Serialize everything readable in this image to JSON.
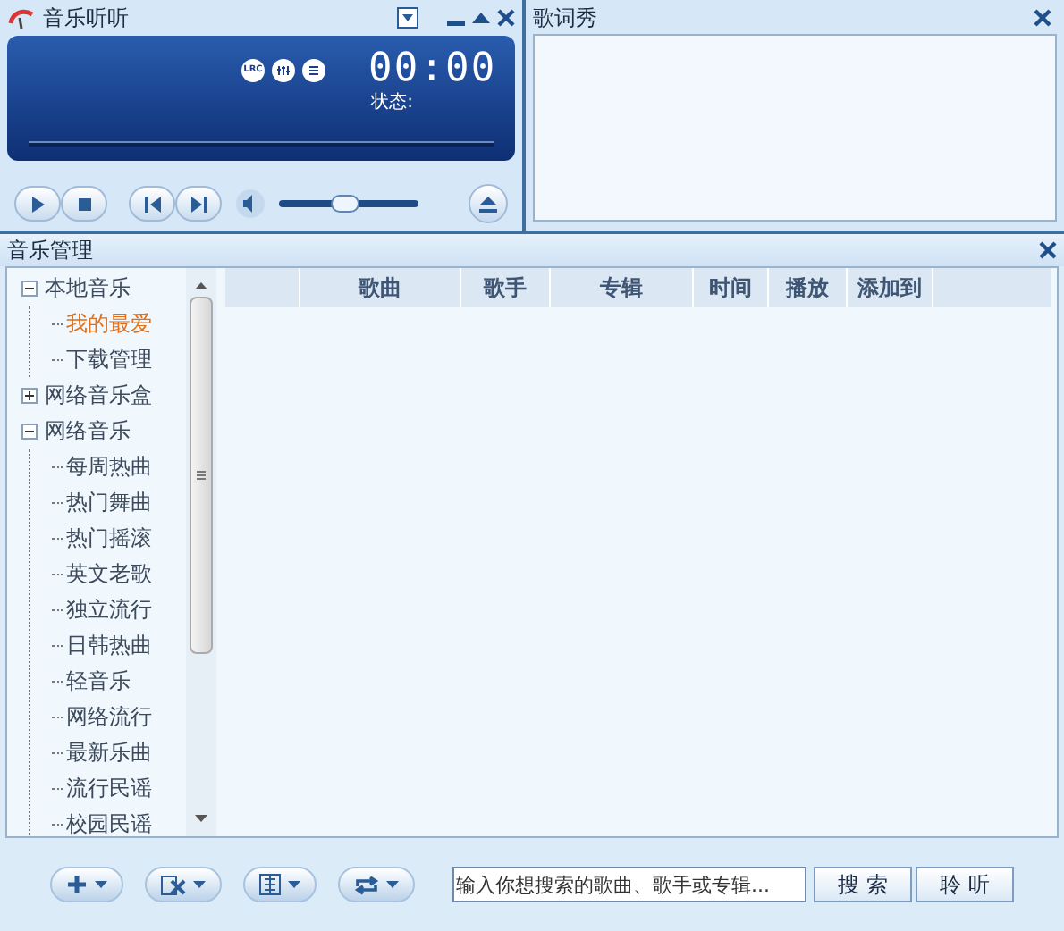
{
  "player": {
    "title": "音乐听听",
    "lrc_label": "LRC",
    "time": "00:00",
    "status": "状态:",
    "progress": {
      "level": 0
    },
    "volume": {
      "level": 0.48
    }
  },
  "lyrics": {
    "title": "歌词秀"
  },
  "manager": {
    "title": "音乐管理",
    "tree": [
      {
        "label": "本地音乐",
        "expanded": true,
        "selected": false,
        "children": [
          {
            "label": "我的最爱",
            "selected": true
          },
          {
            "label": "下载管理",
            "selected": false
          }
        ]
      },
      {
        "label": "网络音乐盒",
        "expanded": false,
        "selected": false
      },
      {
        "label": "网络音乐",
        "expanded": true,
        "selected": false,
        "children": [
          {
            "label": "每周热曲",
            "selected": false
          },
          {
            "label": "热门舞曲",
            "selected": false
          },
          {
            "label": "热门摇滚",
            "selected": false
          },
          {
            "label": "英文老歌",
            "selected": false
          },
          {
            "label": "独立流行",
            "selected": false
          },
          {
            "label": "日韩热曲",
            "selected": false
          },
          {
            "label": "轻音乐",
            "selected": false
          },
          {
            "label": "网络流行",
            "selected": false
          },
          {
            "label": "最新乐曲",
            "selected": false
          },
          {
            "label": "流行民谣",
            "selected": false
          },
          {
            "label": "校园民谣",
            "selected": false
          }
        ]
      }
    ],
    "columns": [
      "歌曲",
      "歌手",
      "专辑",
      "时间",
      "播放",
      "添加到"
    ],
    "search": {
      "placeholder": "输入你想搜索的歌曲、歌手或专辑..."
    },
    "buttons": [
      "搜 索",
      "聆 听"
    ]
  }
}
